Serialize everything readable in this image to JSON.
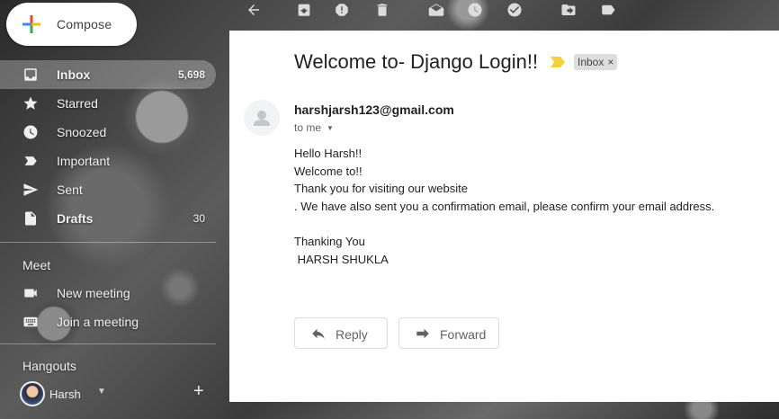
{
  "compose": {
    "label": "Compose"
  },
  "nav": {
    "items": [
      {
        "label": "Inbox",
        "count": "5,698",
        "icon": "inbox-icon"
      },
      {
        "label": "Starred",
        "count": "",
        "icon": "star-icon"
      },
      {
        "label": "Snoozed",
        "count": "",
        "icon": "clock-icon"
      },
      {
        "label": "Important",
        "count": "",
        "icon": "important-icon"
      },
      {
        "label": "Sent",
        "count": "",
        "icon": "send-icon"
      },
      {
        "label": "Drafts",
        "count": "30",
        "icon": "draft-icon"
      }
    ]
  },
  "meet": {
    "title": "Meet",
    "items": [
      {
        "label": "New meeting",
        "icon": "video-icon"
      },
      {
        "label": "Join a meeting",
        "icon": "keyboard-icon"
      }
    ]
  },
  "hangouts": {
    "title": "Hangouts",
    "user": "Harsh"
  },
  "email": {
    "subject": "Welcome to- Django Login!!",
    "label": "Inbox",
    "sender": "harshjarsh123@gmail.com",
    "recipient": "to me",
    "body": [
      "Hello Harsh!!",
      "Welcome to!!",
      "Thank you for visiting our website",
      ". We have also sent you a confirmation email, please confirm your email address.",
      "",
      "Thanking You",
      " HARSH SHUKLA"
    ],
    "reply_label": "Reply",
    "forward_label": "Forward"
  },
  "colors": {
    "pane_bg": "#ffffff",
    "important_marker": "#f4d03f",
    "chip_bg": "#dddddd"
  }
}
